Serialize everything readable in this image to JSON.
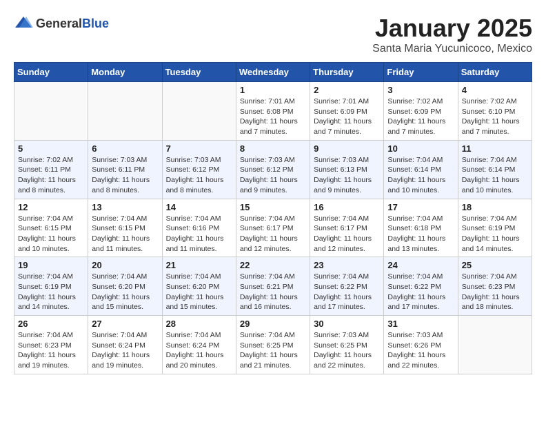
{
  "header": {
    "logo_general": "General",
    "logo_blue": "Blue",
    "month_title": "January 2025",
    "location": "Santa Maria Yucunicoco, Mexico"
  },
  "weekdays": [
    "Sunday",
    "Monday",
    "Tuesday",
    "Wednesday",
    "Thursday",
    "Friday",
    "Saturday"
  ],
  "weeks": [
    [
      {
        "day": "",
        "info": ""
      },
      {
        "day": "",
        "info": ""
      },
      {
        "day": "",
        "info": ""
      },
      {
        "day": "1",
        "info": "Sunrise: 7:01 AM\nSunset: 6:08 PM\nDaylight: 11 hours and 7 minutes."
      },
      {
        "day": "2",
        "info": "Sunrise: 7:01 AM\nSunset: 6:09 PM\nDaylight: 11 hours and 7 minutes."
      },
      {
        "day": "3",
        "info": "Sunrise: 7:02 AM\nSunset: 6:09 PM\nDaylight: 11 hours and 7 minutes."
      },
      {
        "day": "4",
        "info": "Sunrise: 7:02 AM\nSunset: 6:10 PM\nDaylight: 11 hours and 7 minutes."
      }
    ],
    [
      {
        "day": "5",
        "info": "Sunrise: 7:02 AM\nSunset: 6:11 PM\nDaylight: 11 hours and 8 minutes."
      },
      {
        "day": "6",
        "info": "Sunrise: 7:03 AM\nSunset: 6:11 PM\nDaylight: 11 hours and 8 minutes."
      },
      {
        "day": "7",
        "info": "Sunrise: 7:03 AM\nSunset: 6:12 PM\nDaylight: 11 hours and 8 minutes."
      },
      {
        "day": "8",
        "info": "Sunrise: 7:03 AM\nSunset: 6:12 PM\nDaylight: 11 hours and 9 minutes."
      },
      {
        "day": "9",
        "info": "Sunrise: 7:03 AM\nSunset: 6:13 PM\nDaylight: 11 hours and 9 minutes."
      },
      {
        "day": "10",
        "info": "Sunrise: 7:04 AM\nSunset: 6:14 PM\nDaylight: 11 hours and 10 minutes."
      },
      {
        "day": "11",
        "info": "Sunrise: 7:04 AM\nSunset: 6:14 PM\nDaylight: 11 hours and 10 minutes."
      }
    ],
    [
      {
        "day": "12",
        "info": "Sunrise: 7:04 AM\nSunset: 6:15 PM\nDaylight: 11 hours and 10 minutes."
      },
      {
        "day": "13",
        "info": "Sunrise: 7:04 AM\nSunset: 6:15 PM\nDaylight: 11 hours and 11 minutes."
      },
      {
        "day": "14",
        "info": "Sunrise: 7:04 AM\nSunset: 6:16 PM\nDaylight: 11 hours and 11 minutes."
      },
      {
        "day": "15",
        "info": "Sunrise: 7:04 AM\nSunset: 6:17 PM\nDaylight: 11 hours and 12 minutes."
      },
      {
        "day": "16",
        "info": "Sunrise: 7:04 AM\nSunset: 6:17 PM\nDaylight: 11 hours and 12 minutes."
      },
      {
        "day": "17",
        "info": "Sunrise: 7:04 AM\nSunset: 6:18 PM\nDaylight: 11 hours and 13 minutes."
      },
      {
        "day": "18",
        "info": "Sunrise: 7:04 AM\nSunset: 6:19 PM\nDaylight: 11 hours and 14 minutes."
      }
    ],
    [
      {
        "day": "19",
        "info": "Sunrise: 7:04 AM\nSunset: 6:19 PM\nDaylight: 11 hours and 14 minutes."
      },
      {
        "day": "20",
        "info": "Sunrise: 7:04 AM\nSunset: 6:20 PM\nDaylight: 11 hours and 15 minutes."
      },
      {
        "day": "21",
        "info": "Sunrise: 7:04 AM\nSunset: 6:20 PM\nDaylight: 11 hours and 15 minutes."
      },
      {
        "day": "22",
        "info": "Sunrise: 7:04 AM\nSunset: 6:21 PM\nDaylight: 11 hours and 16 minutes."
      },
      {
        "day": "23",
        "info": "Sunrise: 7:04 AM\nSunset: 6:22 PM\nDaylight: 11 hours and 17 minutes."
      },
      {
        "day": "24",
        "info": "Sunrise: 7:04 AM\nSunset: 6:22 PM\nDaylight: 11 hours and 17 minutes."
      },
      {
        "day": "25",
        "info": "Sunrise: 7:04 AM\nSunset: 6:23 PM\nDaylight: 11 hours and 18 minutes."
      }
    ],
    [
      {
        "day": "26",
        "info": "Sunrise: 7:04 AM\nSunset: 6:23 PM\nDaylight: 11 hours and 19 minutes."
      },
      {
        "day": "27",
        "info": "Sunrise: 7:04 AM\nSunset: 6:24 PM\nDaylight: 11 hours and 19 minutes."
      },
      {
        "day": "28",
        "info": "Sunrise: 7:04 AM\nSunset: 6:24 PM\nDaylight: 11 hours and 20 minutes."
      },
      {
        "day": "29",
        "info": "Sunrise: 7:04 AM\nSunset: 6:25 PM\nDaylight: 11 hours and 21 minutes."
      },
      {
        "day": "30",
        "info": "Sunrise: 7:03 AM\nSunset: 6:25 PM\nDaylight: 11 hours and 22 minutes."
      },
      {
        "day": "31",
        "info": "Sunrise: 7:03 AM\nSunset: 6:26 PM\nDaylight: 11 hours and 22 minutes."
      },
      {
        "day": "",
        "info": ""
      }
    ]
  ]
}
